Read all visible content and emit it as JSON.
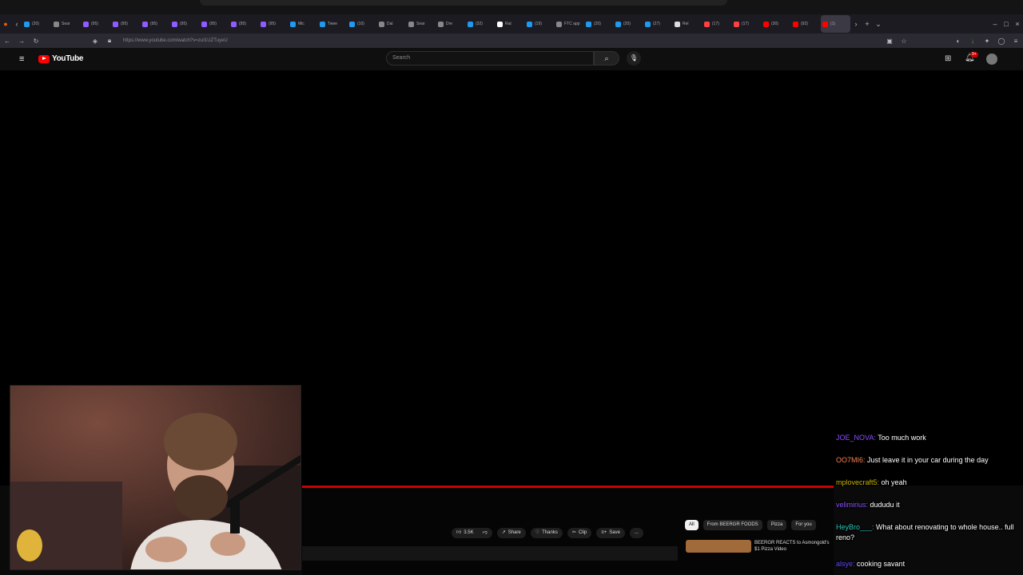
{
  "browser": {
    "tabs": [
      {
        "label": "(20)",
        "color": "#1d9bf0"
      },
      {
        "label": "Sear",
        "color": "#888888"
      },
      {
        "label": "(95)",
        "color": "#8e5cff"
      },
      {
        "label": "(95)",
        "color": "#8e5cff"
      },
      {
        "label": "(95)",
        "color": "#8e5cff"
      },
      {
        "label": "(95)",
        "color": "#8e5cff"
      },
      {
        "label": "(95)",
        "color": "#8e5cff"
      },
      {
        "label": "(95)",
        "color": "#8e5cff"
      },
      {
        "label": "(95)",
        "color": "#8e5cff"
      },
      {
        "label": "Mic",
        "color": "#1d9bf0"
      },
      {
        "label": "Twee",
        "color": "#1d9bf0"
      },
      {
        "label": "(10)",
        "color": "#1d9bf0"
      },
      {
        "label": "Dal",
        "color": "#888888"
      },
      {
        "label": "Sear",
        "color": "#888888"
      },
      {
        "label": "Dre",
        "color": "#888888"
      },
      {
        "label": "(32)",
        "color": "#1d9bf0"
      },
      {
        "label": "Rat",
        "color": "#ffffff"
      },
      {
        "label": "(19)",
        "color": "#1d9bf0"
      },
      {
        "label": "FTC app",
        "color": "#888888"
      },
      {
        "label": "(20)",
        "color": "#1d9bf0"
      },
      {
        "label": "(20)",
        "color": "#1d9bf0"
      },
      {
        "label": "(27)",
        "color": "#1d9bf0"
      },
      {
        "label": "Rel",
        "color": "#dddddd"
      },
      {
        "label": "(17)",
        "color": "#ff4040"
      },
      {
        "label": "(17)",
        "color": "#ff4040"
      },
      {
        "label": "(30)",
        "color": "#ff0000"
      },
      {
        "label": "(92)",
        "color": "#ff0000"
      },
      {
        "label": "(1)",
        "color": "#ff0000"
      }
    ],
    "url": "https://www.youtube.com/watch?v=zuI1UZTuyeU"
  },
  "youtube": {
    "logo_text": "YouTube",
    "search_placeholder": "Search",
    "notification_count": "9+",
    "actions": {
      "likes": "3.5K",
      "share": "Share",
      "thanks": "Thanks",
      "clip": "Clip",
      "save": "Save",
      "more": "..."
    },
    "chips": [
      "All",
      "From BEERGR FOODS",
      "Pizza",
      "For you"
    ],
    "recommended_title": "BEERGR REACTS to Asmongold's $1 Pizza Video"
  },
  "chat": [
    {
      "user": "JOE_NOVA:",
      "text": "Too much work",
      "color": "#8a4fff"
    },
    {
      "user": "OO7MI6:",
      "text": "Just leave it in your car during the day",
      "color": "#ff7f50"
    },
    {
      "user": "mplovecraft5:",
      "text": "oh yeah",
      "color": "#c8b400"
    },
    {
      "user": "velimirius:",
      "text": "dududu it",
      "color": "#8a4fff"
    },
    {
      "user": "HeyBro___:",
      "text": "What about renovating to whole house.. full reno?",
      "color": "#2ec4b6"
    },
    {
      "user": "alsye:",
      "text": "cooking savant",
      "color": "#5b4bff"
    }
  ]
}
